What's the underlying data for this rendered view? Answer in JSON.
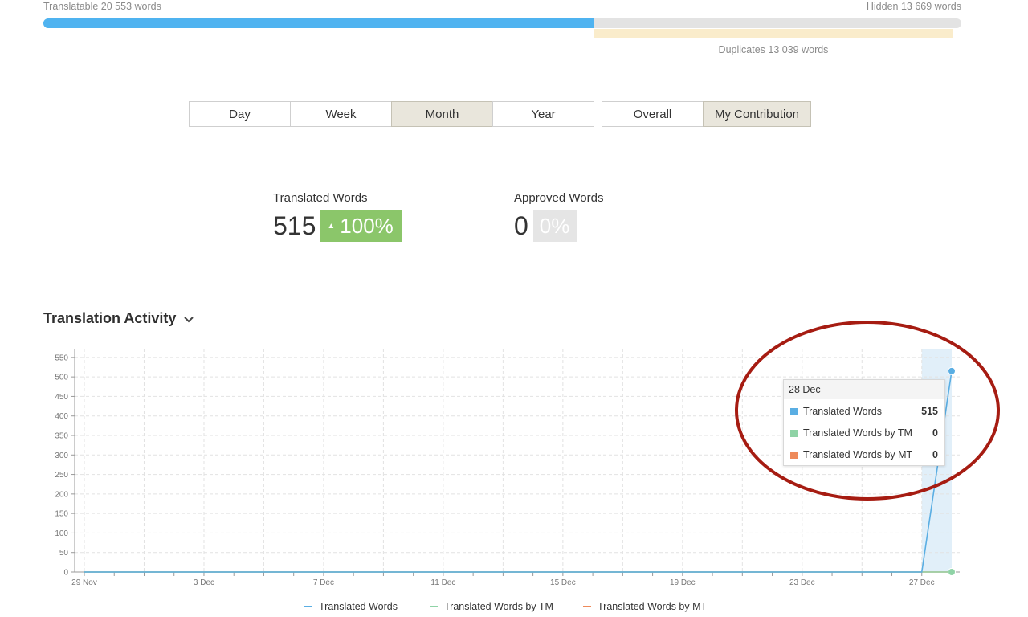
{
  "progress": {
    "translatable_label": "Translatable 20 553 words",
    "hidden_label": "Hidden 13 669 words",
    "duplicates_label": "Duplicates 13 039 words",
    "translatable_fraction": 0.6,
    "colors": {
      "translatable": "#4fb3f0",
      "duplicates": "#faeccb",
      "track": "#e3e3e3"
    }
  },
  "period_buttons": [
    {
      "label": "Day",
      "active": false
    },
    {
      "label": "Week",
      "active": false
    },
    {
      "label": "Month",
      "active": true
    },
    {
      "label": "Year",
      "active": false
    }
  ],
  "scope_buttons": [
    {
      "label": "Overall",
      "active": false
    },
    {
      "label": "My Contribution",
      "active": true
    }
  ],
  "stats": {
    "translated": {
      "label": "Translated Words",
      "value": "515",
      "change": "100%",
      "color": "#8bc66a"
    },
    "approved": {
      "label": "Approved Words",
      "value": "0",
      "change": "0%",
      "color": "#e5e5e5"
    }
  },
  "activity": {
    "title": "Translation Activity",
    "chevron_icon": "chevron-down-icon"
  },
  "tooltip": {
    "date": "28 Dec",
    "rows": [
      {
        "name": "Translated Words",
        "value": "515",
        "color": "#5aaee3"
      },
      {
        "name": "Translated Words by TM",
        "value": "0",
        "color": "#8fd3a6"
      },
      {
        "name": "Translated Words by MT",
        "value": "0",
        "color": "#ee8a5b"
      }
    ]
  },
  "chart_data": {
    "type": "line",
    "title": "",
    "xlabel": "",
    "ylabel": "",
    "x": [
      "29 Nov",
      "30 Nov",
      "1 Dec",
      "2 Dec",
      "3 Dec",
      "4 Dec",
      "5 Dec",
      "6 Dec",
      "7 Dec",
      "8 Dec",
      "9 Dec",
      "10 Dec",
      "11 Dec",
      "12 Dec",
      "13 Dec",
      "14 Dec",
      "15 Dec",
      "16 Dec",
      "17 Dec",
      "18 Dec",
      "19 Dec",
      "20 Dec",
      "21 Dec",
      "22 Dec",
      "23 Dec",
      "24 Dec",
      "25 Dec",
      "26 Dec",
      "27 Dec",
      "28 Dec"
    ],
    "x_tick_labels": [
      "29 Nov",
      "3 Dec",
      "7 Dec",
      "11 Dec",
      "15 Dec",
      "19 Dec",
      "23 Dec",
      "27 Dec"
    ],
    "y_ticks": [
      0,
      50,
      100,
      150,
      200,
      250,
      300,
      350,
      400,
      450,
      500,
      550
    ],
    "ylim": [
      0,
      560
    ],
    "grid": true,
    "legend_position": "bottom",
    "series": [
      {
        "name": "Translated Words",
        "color": "#5aaee3",
        "values": [
          0,
          0,
          0,
          0,
          0,
          0,
          0,
          0,
          0,
          0,
          0,
          0,
          0,
          0,
          0,
          0,
          0,
          0,
          0,
          0,
          0,
          0,
          0,
          0,
          0,
          0,
          0,
          0,
          0,
          515
        ]
      },
      {
        "name": "Translated Words by TM",
        "color": "#8fd3a6",
        "values": [
          0,
          0,
          0,
          0,
          0,
          0,
          0,
          0,
          0,
          0,
          0,
          0,
          0,
          0,
          0,
          0,
          0,
          0,
          0,
          0,
          0,
          0,
          0,
          0,
          0,
          0,
          0,
          0,
          0,
          0
        ]
      },
      {
        "name": "Translated Words by MT",
        "color": "#ee8a5b",
        "values": [
          0,
          0,
          0,
          0,
          0,
          0,
          0,
          0,
          0,
          0,
          0,
          0,
          0,
          0,
          0,
          0,
          0,
          0,
          0,
          0,
          0,
          0,
          0,
          0,
          0,
          0,
          0,
          0,
          0,
          0
        ]
      }
    ],
    "highlighted_category": "28 Dec"
  },
  "annotation": {
    "shape": "ellipse",
    "color": "#a61c12"
  }
}
